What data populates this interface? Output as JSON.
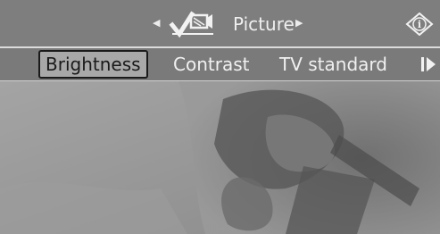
{
  "header": {
    "title": "Picture",
    "left_arrow_icon": "triangle-left",
    "right_arrow_icon": "triangle-right",
    "menu_icon": "picture-settings-icon",
    "info_icon": "info-icon",
    "info_label": "i"
  },
  "tabs": [
    {
      "label": "Brightness",
      "active": true
    },
    {
      "label": "Contrast",
      "active": false
    },
    {
      "label": "TV standard",
      "active": false
    }
  ],
  "tab_scroll_icon": "tab-scroll-right-icon",
  "colors": {
    "bar": "#7e7e7e",
    "active_tab": "#a8a8a8",
    "text": "#f0f0f0",
    "active_text": "#1a1a1a"
  }
}
